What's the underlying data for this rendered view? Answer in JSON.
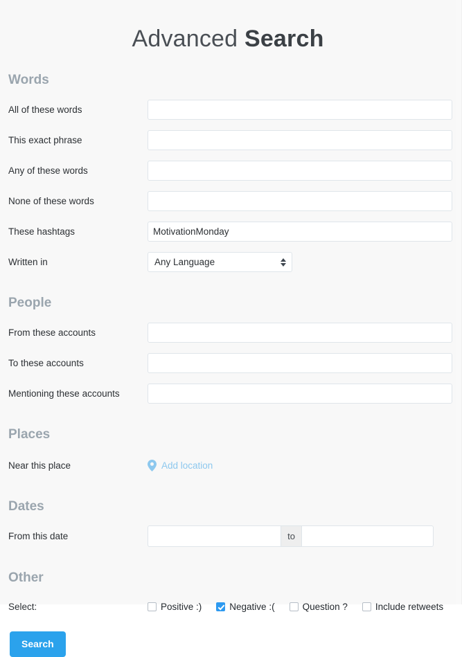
{
  "page": {
    "title_light": "Advanced",
    "title_bold": "Search",
    "accent_blue": "#2ba2ec",
    "heading_color": "#9aa5ae",
    "background": "#f8f8f8",
    "link_blue": "#8dc8ee"
  },
  "words": {
    "heading": "Words",
    "fields": [
      {
        "label": "All of these words",
        "value": "",
        "placeholder": ""
      },
      {
        "label": "This exact phrase",
        "value": "",
        "placeholder": ""
      },
      {
        "label": "Any of these words",
        "value": "",
        "placeholder": ""
      },
      {
        "label": "None of these words",
        "value": "",
        "placeholder": ""
      },
      {
        "label": "These hashtags",
        "value": "MotivationMonday",
        "placeholder": ""
      }
    ],
    "language": {
      "label": "Written in",
      "selected": "Any Language",
      "options": [
        "Any Language"
      ]
    }
  },
  "people": {
    "heading": "People",
    "fields": [
      {
        "label": "From these accounts",
        "value": "",
        "placeholder": ""
      },
      {
        "label": "To these accounts",
        "value": "",
        "placeholder": ""
      },
      {
        "label": "Mentioning these accounts",
        "value": "",
        "placeholder": ""
      }
    ]
  },
  "places": {
    "heading": "Places",
    "label": "Near this place",
    "link_text": "Add location",
    "icon": "map-pin-icon"
  },
  "dates": {
    "heading": "Dates",
    "label": "From this date",
    "from_value": "",
    "from_placeholder": "",
    "separator": "to",
    "to_value": "",
    "to_placeholder": ""
  },
  "other": {
    "heading": "Other",
    "label": "Select:",
    "checkboxes": [
      {
        "label": "Positive :)",
        "checked": false
      },
      {
        "label": "Negative :(",
        "checked": true
      },
      {
        "label": "Question ?",
        "checked": false
      },
      {
        "label": "Include retweets",
        "checked": false
      }
    ]
  },
  "actions": {
    "search_label": "Search"
  }
}
